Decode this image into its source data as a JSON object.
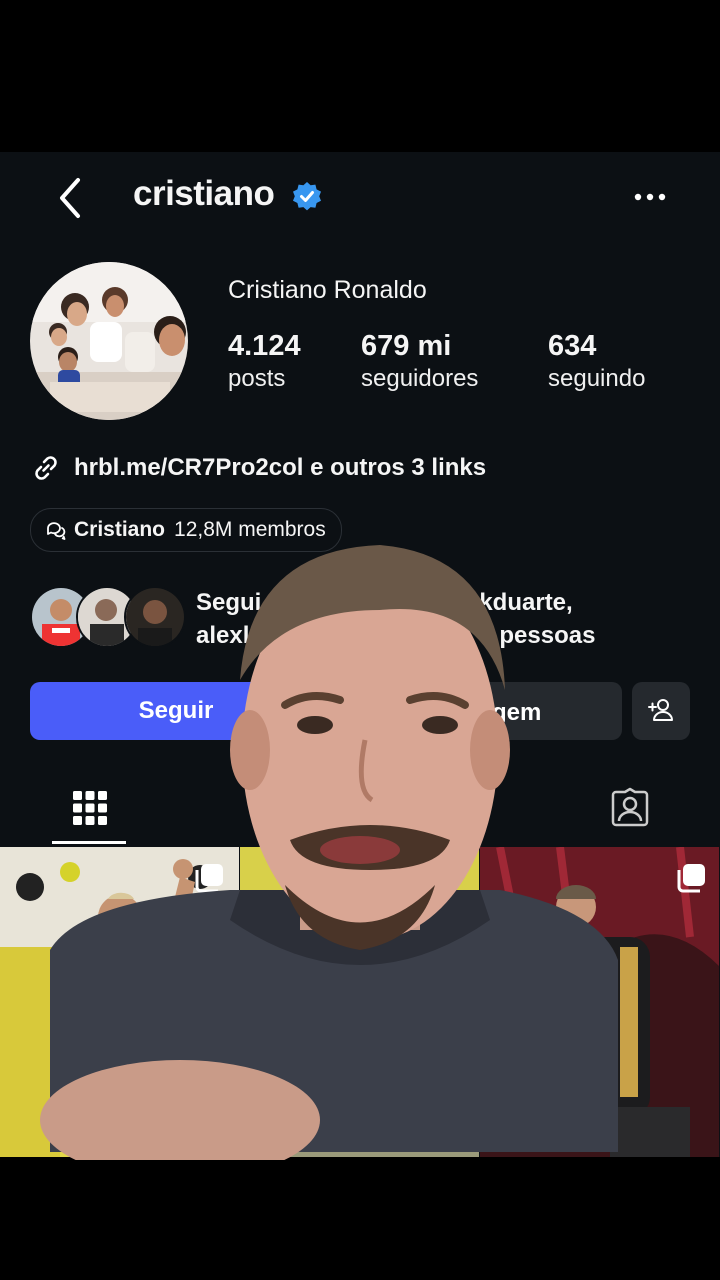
{
  "header": {
    "username": "cristiano",
    "verified_icon": "verified-badge-icon",
    "back_icon": "chevron-left-icon",
    "more_icon": "more-horizontal-icon"
  },
  "profile": {
    "full_name": "Cristiano Ronaldo",
    "stats": [
      {
        "value": "4.124",
        "label": "posts"
      },
      {
        "value": "679 mi",
        "label": "seguidores"
      },
      {
        "value": "634",
        "label": "seguindo"
      }
    ],
    "link_text": "hrbl.me/CR7Pro2col e outros 3 links",
    "community": {
      "name": "Cristiano",
      "members": "12,8M membros"
    },
    "followed_by": {
      "line1": "Segui",
      "line1_end": "tkduarte,",
      "line2": "alexl",
      "line2_end": "pessoas"
    }
  },
  "actions": {
    "follow_label": "Seguir",
    "message_label": "gem",
    "add_user_icon": "add-user-icon"
  },
  "tabs": [
    {
      "name": "grid",
      "icon": "grid-icon",
      "active": true
    },
    {
      "name": "tagged",
      "icon": "tagged-user-icon",
      "active": false
    }
  ],
  "colors": {
    "accent": "#4a5df9",
    "verified": "#3897f0",
    "background": "#0c1014",
    "button_secondary": "#25292e"
  }
}
